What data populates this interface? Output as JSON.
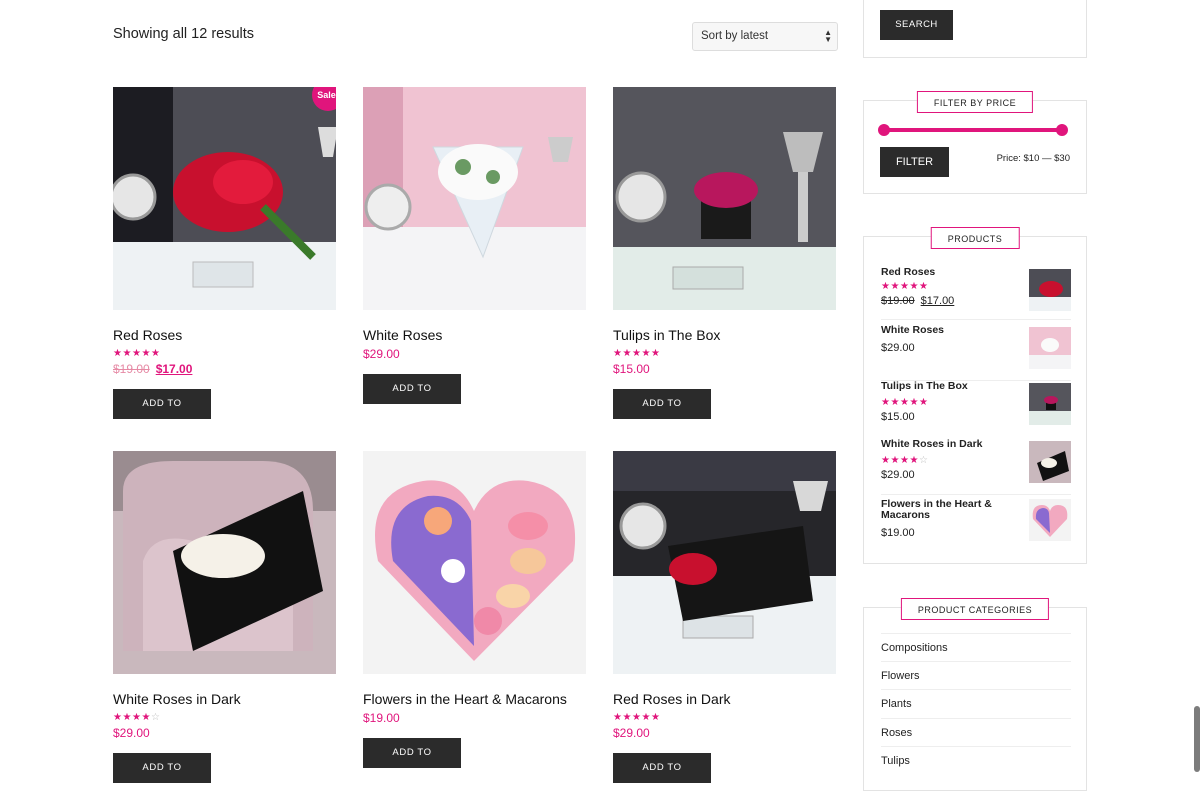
{
  "shop": {
    "results_text": "Showing all 12 results",
    "sort_value": "Sort by latest"
  },
  "products": [
    {
      "name": "Red Roses",
      "rating": 4.5,
      "old_price": "$19.00",
      "price": "$17.00",
      "sale_badge": "Sale!",
      "button": "ADD TO CART",
      "image": "red-roses-bouquet"
    },
    {
      "name": "White Roses",
      "rating": null,
      "price": "$29.00",
      "button": "ADD TO CART",
      "image": "white-roses-bouquet"
    },
    {
      "name": "Tulips in The Box",
      "rating": 5,
      "price": "$15.00",
      "button": "ADD TO CART",
      "image": "pink-tulips-box"
    },
    {
      "name": "White Roses in Dark",
      "rating": 4,
      "price": "$29.00",
      "button": "ADD TO CART",
      "image": "white-roses-black-wrap"
    },
    {
      "name": "Flowers in the Heart & Macarons",
      "rating": null,
      "price": "$19.00",
      "button": "ADD TO CART",
      "image": "heart-box-macarons"
    },
    {
      "name": "Red Roses in Dark",
      "rating": 5,
      "price": "$29.00",
      "button": "ADD TO CART",
      "image": "red-roses-black-wrap"
    }
  ],
  "sidebar": {
    "search_button": "SEARCH",
    "price_filter": {
      "title": "FILTER BY PRICE",
      "button": "FILTER",
      "range_text": "Price: $10 — $30"
    },
    "products_widget": {
      "title": "PRODUCTS",
      "items": [
        {
          "name": "Red Roses",
          "rating": 4.5,
          "old_price": "$19.00",
          "price": "$17.00"
        },
        {
          "name": "White Roses",
          "rating": null,
          "price": "$29.00"
        },
        {
          "name": "Tulips in The Box",
          "rating": 5,
          "price": "$15.00"
        },
        {
          "name": "White Roses in Dark",
          "rating": 4,
          "price": "$29.00"
        },
        {
          "name": "Flowers in the Heart & Macarons",
          "rating": null,
          "price": "$19.00"
        }
      ]
    },
    "categories": {
      "title": "PRODUCT CATEGORIES",
      "items": [
        "Compositions",
        "Flowers",
        "Plants",
        "Roses",
        "Tulips"
      ]
    }
  },
  "colors": {
    "accent": "#e0157c",
    "button": "#2b2b2b"
  }
}
